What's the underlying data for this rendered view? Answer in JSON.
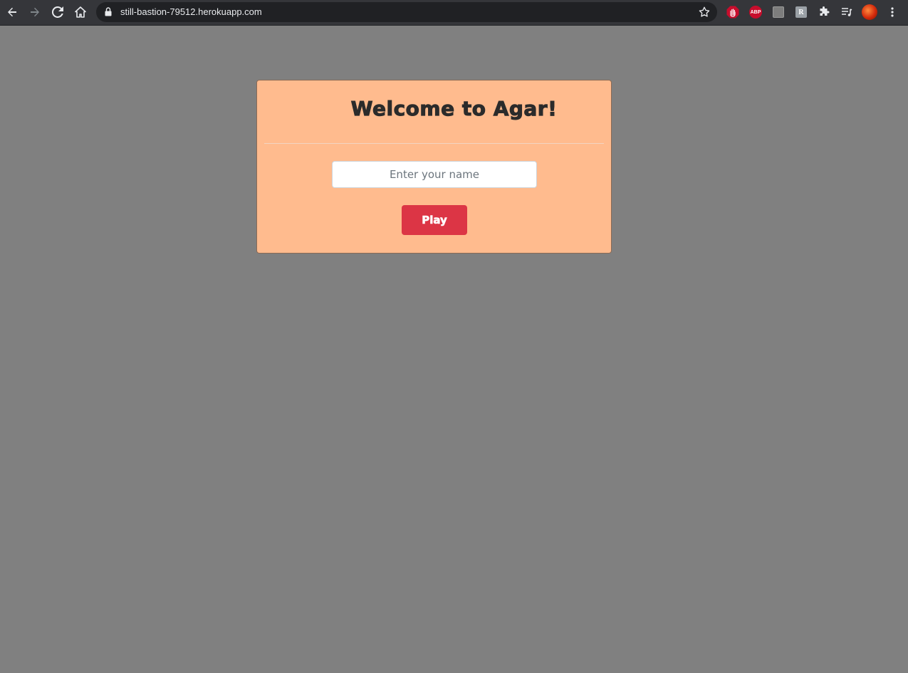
{
  "browser": {
    "url": "still-bastion-79512.herokuapp.com",
    "icons": {
      "back": "back-arrow-icon",
      "forward": "forward-arrow-icon",
      "reload": "reload-icon",
      "home": "home-icon",
      "lock": "lock-icon",
      "bookmark": "star-icon",
      "extensions": [
        "stop-hand-icon",
        "adblock-icon",
        "gray-extension-icon",
        "r-extension-icon",
        "puzzle-icon",
        "media-queue-icon"
      ],
      "profile": "profile-avatar",
      "menu": "kebab-menu-icon"
    },
    "abp_label": "ABP",
    "r_label": "R"
  },
  "page": {
    "background": "#808080",
    "card": {
      "title": "Welcome to Agar!",
      "name_placeholder": "Enter your name",
      "play_label": "Play",
      "accent": "#dc3545",
      "card_color": "#ffbb8e"
    }
  }
}
